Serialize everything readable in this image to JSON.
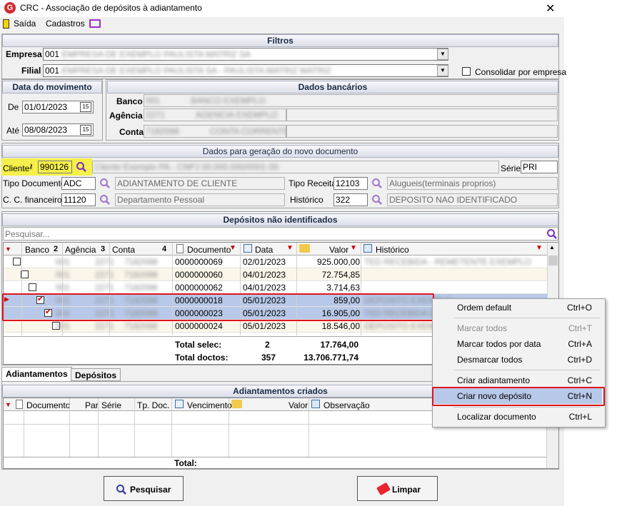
{
  "window": {
    "title": "CRC - Associação de depósitos à adiantamento",
    "icon": "crc-app-icon",
    "close_label": "✕"
  },
  "menu": {
    "saida": "Saída",
    "cadastros": "Cadastros"
  },
  "filtros": {
    "header": "Filtros",
    "empresa_label": "Empresa",
    "empresa_code": "001",
    "empresa_value": "EMPRESA DE EXEMPLO PAULISTA MATRIZ SA",
    "filial_label": "Filial",
    "filial_code": "001",
    "filial_value": "EMPRESA DE EXEMPLO PAULISTA SA - PAULISTA MATRIZ MATRIZ",
    "consolidar_label": "Consolidar por empresa"
  },
  "data_movimento": {
    "header": "Data do movimento",
    "de_label": "De",
    "de_value": "01/01/2023",
    "ate_label": "Até",
    "ate_value": "08/08/2023"
  },
  "dados_bancarios": {
    "header": "Dados bancários",
    "banco_label": "Banco",
    "banco_code": "001",
    "banco_name": "BANCO EXEMPLO",
    "agencia_label": "Agência",
    "agencia_code": "2271",
    "agencia_name": "AGENCIA EXEMPLO",
    "conta_label": "Conta",
    "conta_code": "7182098",
    "conta_name": "CONTA CORRENTE"
  },
  "novo_documento": {
    "header": "Dados para geração do novo documento",
    "cliente_label": "Cliente",
    "cliente_value": "990126",
    "cliente_name": "Cliente Exemplo PA - CNPJ 00.000.000/0001-00",
    "serie_label": "Série",
    "serie_value": "PRI",
    "tipo_doc_label": "Tipo Documento",
    "tipo_doc_code": "ADC",
    "tipo_doc_name": "ADIANTAMENTO DE CLIENTE",
    "tipo_receita_label": "Tipo Receita",
    "tipo_receita_code": "12103",
    "tipo_receita_name": "Alugueis(terminais proprios)",
    "cc_label": "C. C. financeiro",
    "cc_code": "11120",
    "cc_name": "Departamento Pessoal",
    "historico_label": "Histórico",
    "historico_code": "322",
    "historico_name": "DEPOSITO NAO IDENTIFICADO"
  },
  "depositos": {
    "header": "Depósitos não identificados",
    "search_placeholder": "Pesquisar...",
    "columns": {
      "banco": "Banco",
      "banco_sort": "2",
      "agencia": "Agência",
      "agencia_sort": "3",
      "conta": "Conta",
      "conta_sort": "4",
      "documento": "Documento",
      "data": "Data",
      "valor": "Valor",
      "historico": "Histórico"
    },
    "rows": [
      {
        "banco": "001",
        "agencia": "2271",
        "conta": "7182098",
        "documento": "0000000069",
        "data": "02/01/2023",
        "valor": "925.000,00",
        "historico": "TED RECEBIDA - REMETENTE EXEMPLO",
        "checked": false
      },
      {
        "banco": "001",
        "agencia": "2271",
        "conta": "7182098",
        "documento": "0000000060",
        "data": "04/01/2023",
        "valor": "72.754,85",
        "historico": "",
        "checked": false
      },
      {
        "banco": "001",
        "agencia": "2271",
        "conta": "7182098",
        "documento": "0000000062",
        "data": "04/01/2023",
        "valor": "3.714,63",
        "historico": "",
        "checked": false
      },
      {
        "banco": "001",
        "agencia": "2271",
        "conta": "7182098",
        "documento": "0000000018",
        "data": "05/01/2023",
        "valor": "859,00",
        "historico": "DEPOSITO EXEMPLO",
        "checked": true
      },
      {
        "banco": "001",
        "agencia": "2271",
        "conta": "7182098",
        "documento": "0000000023",
        "data": "05/01/2023",
        "valor": "16.905,00",
        "historico": "TED RECEBIDA EXEMPLO",
        "checked": true
      },
      {
        "banco": "001",
        "agencia": "2271",
        "conta": "7182098",
        "documento": "0000000024",
        "data": "05/01/2023",
        "valor": "18.546,00",
        "historico": "DEPOSITO EXEMPLO",
        "checked": false
      }
    ],
    "total_selec_label": "Total selec:",
    "total_selec_count": "2",
    "total_selec_value": "17.764,00",
    "total_doctos_label": "Total doctos:",
    "total_doctos_count": "357",
    "total_doctos_value": "13.706.771,74"
  },
  "tabs": {
    "adiantamentos": "Adiantamentos",
    "depositos": "Depósitos"
  },
  "adiantamentos": {
    "header": "Adiantamentos criados",
    "columns": {
      "documento": "Documento",
      "par": "Par",
      "serie": "Série",
      "tp_doc": "Tp. Doc.",
      "vencimento": "Vencimento",
      "valor": "Valor",
      "observacao": "Observação"
    },
    "total_label": "Total:"
  },
  "buttons": {
    "pesquisar": "Pesquisar",
    "limpar": "Limpar"
  },
  "context_menu": {
    "items": [
      {
        "label": "Ordem default",
        "shortcut": "Ctrl+O",
        "enabled": true
      },
      {
        "label": "Marcar todos",
        "shortcut": "Ctrl+T",
        "enabled": false
      },
      {
        "label": "Marcar todos por data",
        "shortcut": "Ctrl+A",
        "enabled": true
      },
      {
        "label": "Desmarcar todos",
        "shortcut": "Ctrl+D",
        "enabled": true
      },
      {
        "label": "Criar adiantamento",
        "shortcut": "Ctrl+C",
        "enabled": true
      },
      {
        "label": "Criar novo depósito",
        "shortcut": "Ctrl+N",
        "enabled": true
      },
      {
        "label": "Localizar documento",
        "shortcut": "Ctrl+L",
        "enabled": true
      }
    ]
  },
  "colors": {
    "highlight_red": "#e0141e",
    "selected_row": "#b8c8e8",
    "cliente_highlight": "#f5f04a",
    "search_icon": "#7b2fbe"
  }
}
